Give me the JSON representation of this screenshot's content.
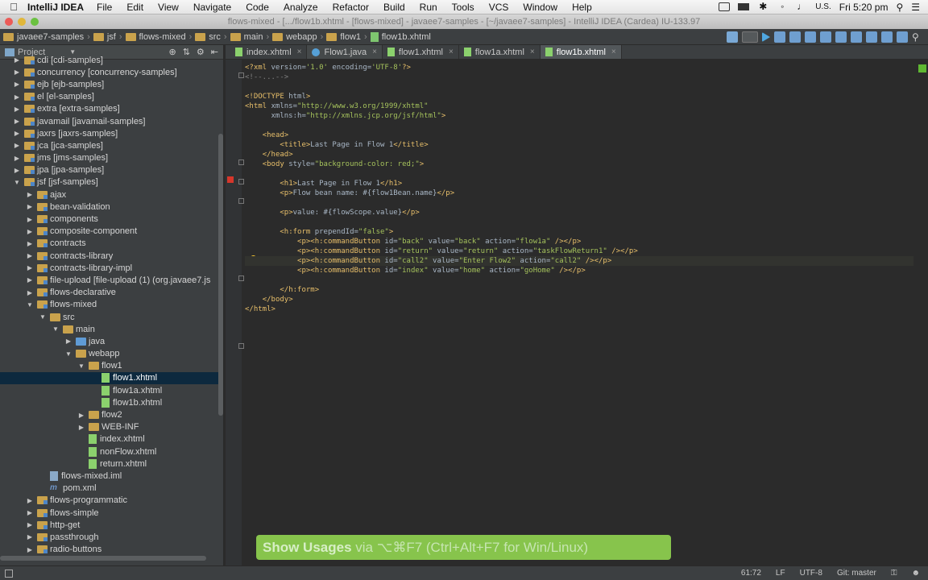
{
  "menubar": {
    "app_name": "IntelliJ IDEA",
    "items": [
      "File",
      "Edit",
      "View",
      "Navigate",
      "Code",
      "Analyze",
      "Refactor",
      "Build",
      "Run",
      "Tools",
      "VCS",
      "Window",
      "Help"
    ],
    "input_locale": "U.S.",
    "clock": "Fri 5:20 pm"
  },
  "titlebar": {
    "text": "flows-mixed - [.../flow1b.xhtml - [flows-mixed] - javaee7-samples - [~/javaee7-samples] - IntelliJ IDEA (Cardea) IU-133.97"
  },
  "breadcrumbs": [
    "javaee7-samples",
    "jsf",
    "flows-mixed",
    "src",
    "main",
    "webapp",
    "flow1",
    "flow1b.xhtml"
  ],
  "project_panel": {
    "title": "Project",
    "tree": [
      {
        "label": "cdi [cdi-samples]",
        "indent": 1,
        "icon": "module-folder",
        "arrow": "right"
      },
      {
        "label": "concurrency [concurrency-samples]",
        "indent": 1,
        "icon": "module-folder",
        "arrow": "right"
      },
      {
        "label": "ejb [ejb-samples]",
        "indent": 1,
        "icon": "module-folder",
        "arrow": "right"
      },
      {
        "label": "el [el-samples]",
        "indent": 1,
        "icon": "module-folder",
        "arrow": "right"
      },
      {
        "label": "extra [extra-samples]",
        "indent": 1,
        "icon": "module-folder",
        "arrow": "right"
      },
      {
        "label": "javamail [javamail-samples]",
        "indent": 1,
        "icon": "module-folder",
        "arrow": "right"
      },
      {
        "label": "jaxrs [jaxrs-samples]",
        "indent": 1,
        "icon": "module-folder",
        "arrow": "right"
      },
      {
        "label": "jca [jca-samples]",
        "indent": 1,
        "icon": "module-folder",
        "arrow": "right"
      },
      {
        "label": "jms [jms-samples]",
        "indent": 1,
        "icon": "module-folder",
        "arrow": "right"
      },
      {
        "label": "jpa [jpa-samples]",
        "indent": 1,
        "icon": "module-folder",
        "arrow": "right"
      },
      {
        "label": "jsf [jsf-samples]",
        "indent": 1,
        "icon": "module-folder",
        "arrow": "down"
      },
      {
        "label": "ajax",
        "indent": 2,
        "icon": "module-folder",
        "arrow": "right"
      },
      {
        "label": "bean-validation",
        "indent": 2,
        "icon": "module-folder",
        "arrow": "right"
      },
      {
        "label": "components",
        "indent": 2,
        "icon": "module-folder",
        "arrow": "right"
      },
      {
        "label": "composite-component",
        "indent": 2,
        "icon": "module-folder",
        "arrow": "right"
      },
      {
        "label": "contracts",
        "indent": 2,
        "icon": "module-folder",
        "arrow": "right"
      },
      {
        "label": "contracts-library",
        "indent": 2,
        "icon": "module-folder",
        "arrow": "right"
      },
      {
        "label": "contracts-library-impl",
        "indent": 2,
        "icon": "module-folder",
        "arrow": "right"
      },
      {
        "label": "file-upload [file-upload (1) (org.javaee7.js",
        "indent": 2,
        "icon": "module-folder",
        "arrow": "right"
      },
      {
        "label": "flows-declarative",
        "indent": 2,
        "icon": "module-folder",
        "arrow": "right"
      },
      {
        "label": "flows-mixed",
        "indent": 2,
        "icon": "module-folder",
        "arrow": "down"
      },
      {
        "label": "src",
        "indent": 3,
        "icon": "folder",
        "arrow": "down"
      },
      {
        "label": "main",
        "indent": 4,
        "icon": "folder",
        "arrow": "down"
      },
      {
        "label": "java",
        "indent": 5,
        "icon": "blue-folder",
        "arrow": "right"
      },
      {
        "label": "webapp",
        "indent": 5,
        "icon": "folder",
        "arrow": "down"
      },
      {
        "label": "flow1",
        "indent": 6,
        "icon": "folder",
        "arrow": "down"
      },
      {
        "label": "flow1.xhtml",
        "indent": 7,
        "icon": "file",
        "arrow": "",
        "selected": true
      },
      {
        "label": "flow1a.xhtml",
        "indent": 7,
        "icon": "file",
        "arrow": ""
      },
      {
        "label": "flow1b.xhtml",
        "indent": 7,
        "icon": "file",
        "arrow": ""
      },
      {
        "label": "flow2",
        "indent": 6,
        "icon": "folder",
        "arrow": "right"
      },
      {
        "label": "WEB-INF",
        "indent": 6,
        "icon": "folder",
        "arrow": "right"
      },
      {
        "label": "index.xhtml",
        "indent": 6,
        "icon": "file",
        "arrow": "",
        "leaf_offset": true
      },
      {
        "label": "nonFlow.xhtml",
        "indent": 6,
        "icon": "file",
        "arrow": "",
        "leaf_offset": true
      },
      {
        "label": "return.xhtml",
        "indent": 6,
        "icon": "file",
        "arrow": "",
        "leaf_offset": true
      },
      {
        "label": "flows-mixed.iml",
        "indent": 3,
        "icon": "iml",
        "arrow": "",
        "leaf_offset": true
      },
      {
        "label": "pom.xml",
        "indent": 3,
        "icon": "pom",
        "arrow": "",
        "leaf_offset": true
      },
      {
        "label": "flows-programmatic",
        "indent": 2,
        "icon": "module-folder",
        "arrow": "right"
      },
      {
        "label": "flows-simple",
        "indent": 2,
        "icon": "module-folder",
        "arrow": "right"
      },
      {
        "label": "http-get",
        "indent": 2,
        "icon": "module-folder",
        "arrow": "right"
      },
      {
        "label": "passthrough",
        "indent": 2,
        "icon": "module-folder",
        "arrow": "right"
      },
      {
        "label": "radio-buttons",
        "indent": 2,
        "icon": "module-folder",
        "arrow": "right"
      }
    ]
  },
  "tabs": [
    {
      "label": "index.xhtml",
      "type": "xhtml",
      "active": false
    },
    {
      "label": "Flow1.java",
      "type": "java",
      "active": false
    },
    {
      "label": "flow1.xhtml",
      "type": "xhtml",
      "active": false
    },
    {
      "label": "flow1a.xhtml",
      "type": "xhtml",
      "active": false
    },
    {
      "label": "flow1b.xhtml",
      "type": "xhtml",
      "active": true
    }
  ],
  "code_lines": [
    "<?xml version='1.0' encoding='UTF-8'?>",
    "<!--...-->",
    "",
    "<!DOCTYPE html>",
    "<html xmlns=\"http://www.w3.org/1999/xhtml\"",
    "      xmlns:h=\"http://xmlns.jcp.org/jsf/html\">",
    "",
    "    <head>",
    "        <title>Last Page in Flow 1</title>",
    "    </head>",
    "    <body style=\"background-color: red;\">",
    "",
    "        <h1>Last Page in Flow 1</h1>",
    "        <p>Flow bean name: #{flow1Bean.name}</p>",
    "",
    "        <p>value: #{flowScope.value}</p>",
    "",
    "        <h:form prependId=\"false\">",
    "            <p><h:commandButton id=\"back\" value=\"back\" action=\"flow1a\" /></p>",
    "            <p><h:commandButton id=\"return\" value=\"return\" action=\"taskFlowReturn1\" /></p>",
    "            <p><h:commandButton id=\"call2\" value=\"Enter Flow2\" action=\"call2\" /></p>",
    "            <p><h:commandButton id=\"index\" value=\"home\" action=\"goHome\" /></p>",
    "",
    "        </h:form>",
    "    </body>",
    "</html>"
  ],
  "status": {
    "position": "61:72",
    "line_sep": "LF",
    "encoding": "UTF-8",
    "vcs": "Git: master"
  },
  "tip": {
    "prefix": "Show Usages",
    "rest": " via ⌥⌘F7 (Ctrl+Alt+F7 for Win/Linux)"
  },
  "colors": {
    "editor_bg": "#2b2b2b",
    "panel_bg": "#3c3f41",
    "tag": "#e8bf6a",
    "string": "#a5c25c",
    "selection": "#0d293e",
    "tip_bg": "#8fd14f"
  }
}
